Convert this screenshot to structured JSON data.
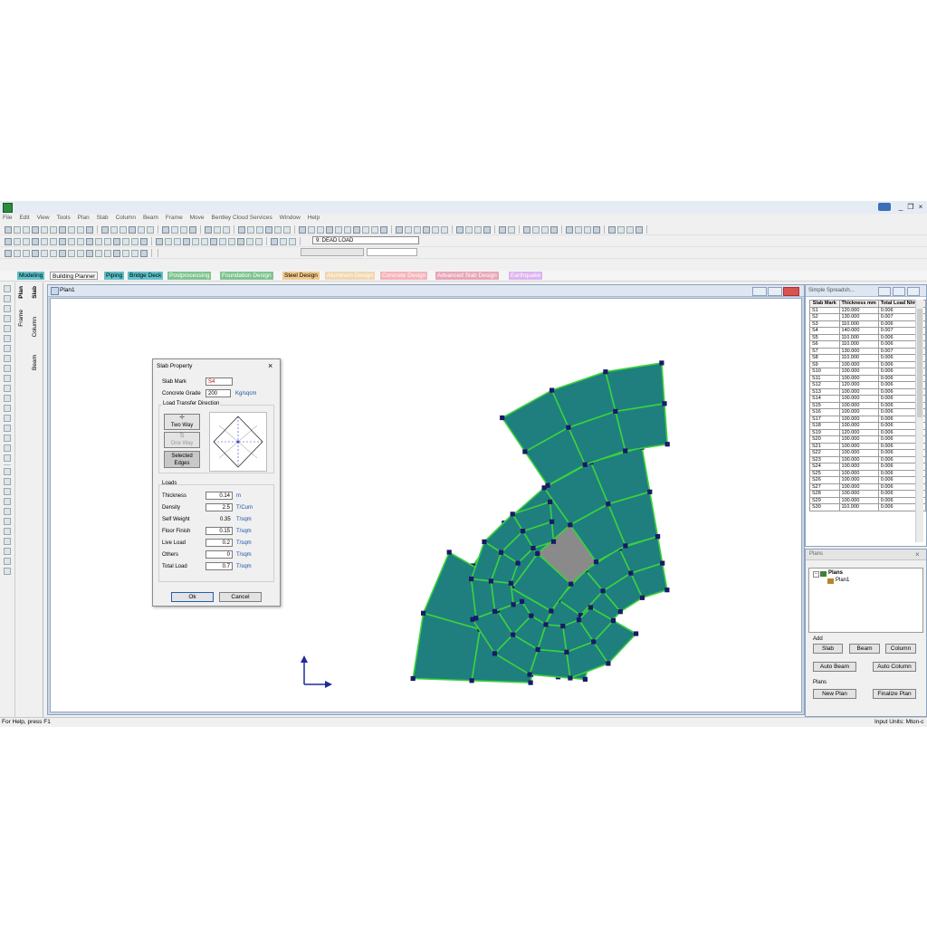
{
  "window": {
    "controls": [
      "_",
      "❐",
      "×"
    ]
  },
  "menu": [
    "File",
    "Edit",
    "View",
    "Tools",
    "Plan",
    "Slab",
    "Column",
    "Beam",
    "Frame",
    "Move",
    "Bentley Cloud Services",
    "Window",
    "Help"
  ],
  "toolbar": {
    "load_case": "9: DEAD LOAD"
  },
  "module_tabs": [
    {
      "label": "Modeling",
      "bg": "#5fc1c9"
    },
    {
      "label": "Building Planner",
      "bg": "#f5f5f5"
    },
    {
      "label": "Piping",
      "bg": "#5fc1c9"
    },
    {
      "label": "Bridge Deck",
      "bg": "#5fc1c9"
    },
    {
      "label": "Postprocessing",
      "bg": "#7fc48f"
    },
    {
      "label": "Foundation Design",
      "bg": "#7fc48f"
    },
    {
      "label": "Steel Design",
      "bg": "#f2c98e"
    },
    {
      "label": "Aluminum Design",
      "bg": "#f2c98e"
    },
    {
      "label": "Concrete Design",
      "bg": "#f4b3b9"
    },
    {
      "label": "Advanced Slab Design",
      "bg": "#e8a6b8"
    },
    {
      "label": "Earthquake",
      "bg": "#dcb3f0"
    }
  ],
  "side_tabs": {
    "plan": "Plan",
    "frame": "Frame",
    "slab": "Slab",
    "column": "Column",
    "beam": "Beam"
  },
  "plan_window": {
    "title": "Plan1"
  },
  "slab_property": {
    "title": "Slab Property",
    "slab_mark_label": "Slab Mark",
    "slab_mark": "S4",
    "concrete_grade_label": "Concrete Grade",
    "concrete_grade": "200",
    "concrete_grade_unit": "Kg/sqcm",
    "load_transfer_label": "Load Transfer Direction",
    "two_way": "Two Way",
    "one_way": "One Way",
    "selected_edges": "Selected Edges",
    "loads_label": "Loads",
    "rows": [
      {
        "label": "Thickness",
        "value": "0.14",
        "unit": "m"
      },
      {
        "label": "Density",
        "value": "2.5",
        "unit": "T/Cum"
      },
      {
        "label": "Self Weight",
        "value": "0.35",
        "unit": "T/sqm"
      },
      {
        "label": "Floor Finish",
        "value": "0.15",
        "unit": "T/sqm"
      },
      {
        "label": "Live Load",
        "value": "0.2",
        "unit": "T/sqm"
      },
      {
        "label": "Others",
        "value": "0",
        "unit": "T/sqm"
      },
      {
        "label": "Total Load",
        "value": "0.7",
        "unit": "T/sqm"
      }
    ],
    "ok": "Ok",
    "cancel": "Cancel"
  },
  "slab_table": {
    "title": "Simple Spreadsh...",
    "headers": [
      "Slab Mark",
      "Thickness mm",
      "Total Load N/mm2"
    ],
    "rows": [
      [
        "S1",
        "120.000",
        "0.006"
      ],
      [
        "S2",
        "130.000",
        "0.007"
      ],
      [
        "S3",
        "110.000",
        "0.006"
      ],
      [
        "S4",
        "140.000",
        "0.007"
      ],
      [
        "S5",
        "110.000",
        "0.006"
      ],
      [
        "S6",
        "110.000",
        "0.006"
      ],
      [
        "S7",
        "130.000",
        "0.007"
      ],
      [
        "S8",
        "110.000",
        "0.006"
      ],
      [
        "S9",
        "100.000",
        "0.006"
      ],
      [
        "S10",
        "100.000",
        "0.006"
      ],
      [
        "S11",
        "100.000",
        "0.006"
      ],
      [
        "S12",
        "120.000",
        "0.006"
      ],
      [
        "S13",
        "100.000",
        "0.006"
      ],
      [
        "S14",
        "100.000",
        "0.006"
      ],
      [
        "S15",
        "100.000",
        "0.006"
      ],
      [
        "S16",
        "100.000",
        "0.006"
      ],
      [
        "S17",
        "100.000",
        "0.006"
      ],
      [
        "S18",
        "100.000",
        "0.006"
      ],
      [
        "S19",
        "120.000",
        "0.006"
      ],
      [
        "S20",
        "100.000",
        "0.006"
      ],
      [
        "S21",
        "100.000",
        "0.006"
      ],
      [
        "S22",
        "100.000",
        "0.006"
      ],
      [
        "S23",
        "100.000",
        "0.006"
      ],
      [
        "S24",
        "100.000",
        "0.006"
      ],
      [
        "S25",
        "100.000",
        "0.006"
      ],
      [
        "S26",
        "100.000",
        "0.006"
      ],
      [
        "S27",
        "100.000",
        "0.006"
      ],
      [
        "S28",
        "100.000",
        "0.006"
      ],
      [
        "S29",
        "100.000",
        "0.006"
      ],
      [
        "S30",
        "110.000",
        "0.006"
      ]
    ]
  },
  "plans_panel": {
    "title": "Plans",
    "tree_root": "Plans",
    "tree_child": "Plan1",
    "add_label": "Add",
    "slab_btn": "Slab",
    "beam_btn": "Beam",
    "column_btn": "Column",
    "auto_beam_btn": "Auto Beam",
    "auto_column_btn": "Auto Column",
    "plans_label": "Plans",
    "new_plan_btn": "New Plan",
    "finalize_btn": "Finalize Plan"
  },
  "status": {
    "help": "For Help, press F1",
    "units": "Input Units:  Mton-c"
  },
  "colors": {
    "slab_fill": "#1f7f7f",
    "beam": "#3cd23c",
    "column": "#1a1a66",
    "selected_slab": "#8a8a8a"
  }
}
